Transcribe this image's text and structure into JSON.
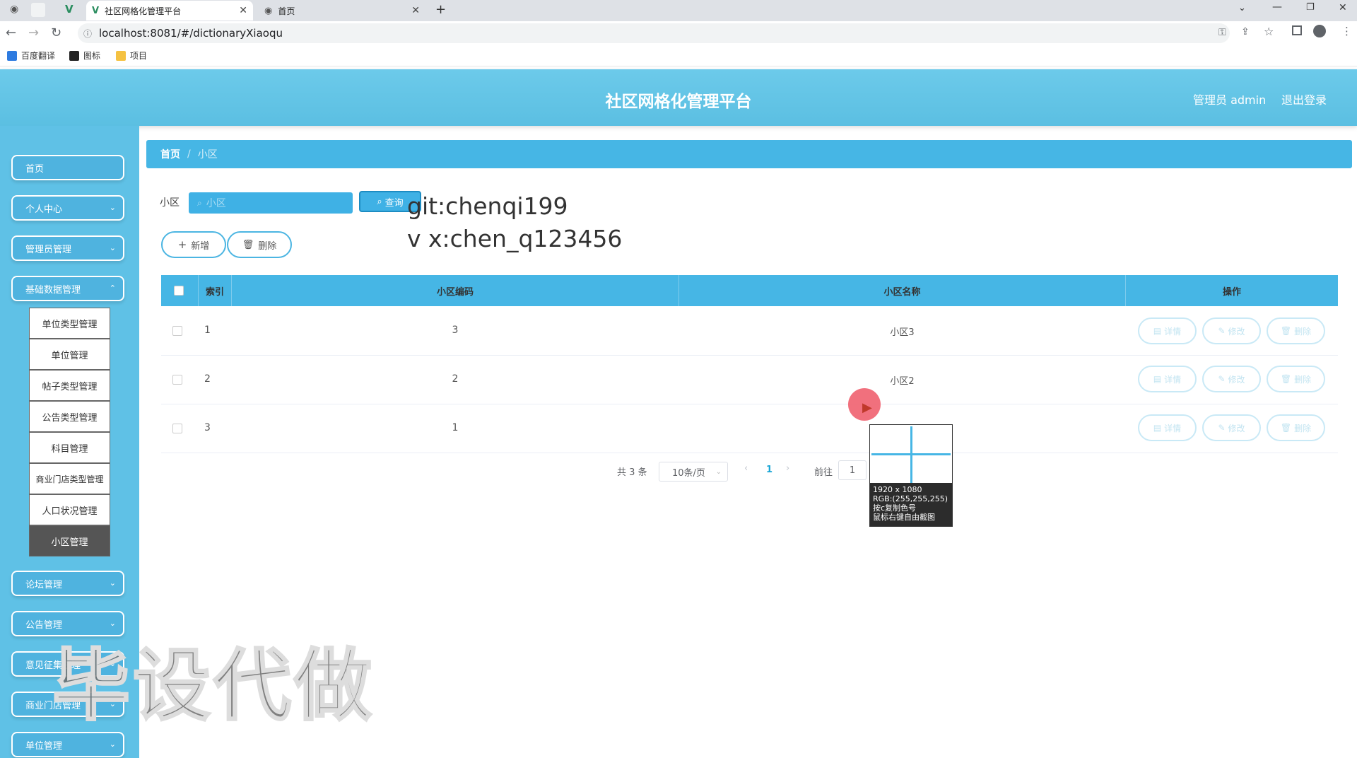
{
  "browser": {
    "tabs": [
      {
        "title": "社区网格化管理平台",
        "active": true
      },
      {
        "title": "首页",
        "active": false
      }
    ],
    "url": "localhost:8081/#/dictionaryXiaoqu",
    "bookmarks": [
      "百度翻译",
      "图标",
      "项目"
    ]
  },
  "header": {
    "title": "社区网格化管理平台",
    "user": "管理员 admin",
    "logout": "退出登录"
  },
  "sidebar": {
    "items": [
      {
        "label": "首页"
      },
      {
        "label": "个人中心"
      },
      {
        "label": "管理员管理"
      },
      {
        "label": "基础数据管理"
      },
      {
        "label": "论坛管理"
      },
      {
        "label": "公告管理"
      },
      {
        "label": "意见征集管理"
      },
      {
        "label": "商业门店管理"
      },
      {
        "label": "单位管理"
      }
    ],
    "submenu": [
      "单位类型管理",
      "单位管理",
      "帖子类型管理",
      "公告类型管理",
      "科目管理",
      "商业门店类型管理",
      "人口状况管理",
      "小区管理"
    ]
  },
  "breadcrumb": {
    "home": "首页",
    "sep": "/",
    "current": "小区"
  },
  "search": {
    "label": "小区",
    "placeholder": "小区",
    "button": "查询"
  },
  "toolbar": {
    "add": "新增",
    "delete": "删除"
  },
  "watermark_text": {
    "line1": "git:chenqi199",
    "line2": "v x:chen_q123456"
  },
  "table": {
    "columns": [
      "索引",
      "小区编码",
      "小区名称",
      "操作"
    ],
    "rows": [
      {
        "index": "1",
        "code": "3",
        "name": "小区3"
      },
      {
        "index": "2",
        "code": "2",
        "name": "小区2"
      },
      {
        "index": "3",
        "code": "1",
        "name": ""
      }
    ],
    "actions": {
      "detail": "详情",
      "edit": "修改",
      "delete": "删除"
    }
  },
  "pagination": {
    "total": "共 3 条",
    "page_size": "10条/页",
    "current": "1",
    "goto_label": "前往",
    "goto_value": "1"
  },
  "screenshot_tool": {
    "resolution": "1920 x 1080",
    "rgb": "RGB:(255,255,255)",
    "hint1": "按c复制色号",
    "hint2": "鼠标右键自由截图"
  },
  "overlay_watermark": "毕设代做",
  "colors": {
    "primary": "#46b6e5",
    "header": "#5fc1e6",
    "active_sub": "#555555"
  }
}
